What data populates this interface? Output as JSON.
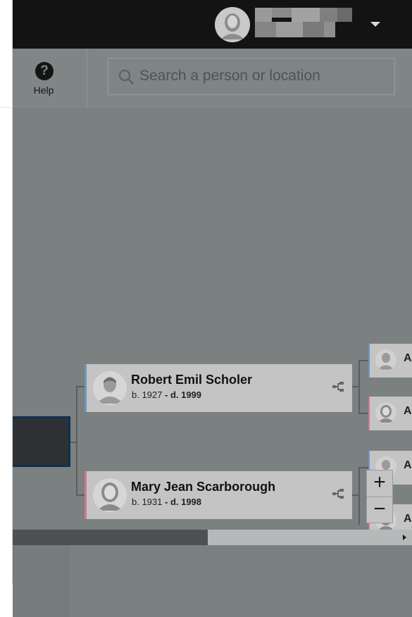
{
  "header": {
    "username": "",
    "menu_caret": "chevron-down-icon"
  },
  "toolbar": {
    "help_label": "Help",
    "help_icon": "?",
    "search_placeholder": "Search a person or location"
  },
  "tree": {
    "people": [
      {
        "name": "Robert Emil Scholer",
        "birth": "b. 1927",
        "dash": " - ",
        "death": "d. 1999",
        "gender": "male"
      },
      {
        "name": "Mary Jean Scarborough",
        "birth": "b. 1931",
        "dash": " - ",
        "death": "d. 1998",
        "gender": "female"
      }
    ],
    "ancestors": [
      {
        "initial": "A",
        "gender": "male"
      },
      {
        "initial": "A",
        "gender": "female"
      },
      {
        "initial": "A",
        "gender": "male"
      },
      {
        "initial": "A",
        "gender": "female"
      }
    ]
  },
  "zoom": {
    "in_label": "+",
    "out_label": "−"
  },
  "colors": {
    "male_accent": "#6d96bf",
    "female_accent": "#cc7a8a",
    "topbar": "#131313",
    "overlay": "#7b8080"
  }
}
